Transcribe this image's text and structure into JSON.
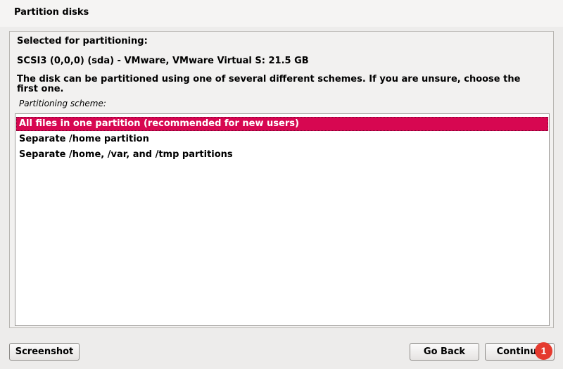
{
  "header": {
    "title": "Partition disks"
  },
  "panel": {
    "selected_label": "Selected for partitioning:",
    "disk": "SCSI3 (0,0,0) (sda) - VMware, VMware Virtual S: 21.5 GB",
    "description": "The disk can be partitioned using one of several different schemes. If you are unsure, choose the first one.",
    "scheme_label": "Partitioning scheme:"
  },
  "schemes": [
    {
      "label": "All files in one partition (recommended for new users)",
      "selected": true
    },
    {
      "label": "Separate /home partition",
      "selected": false
    },
    {
      "label": "Separate /home, /var, and /tmp partitions",
      "selected": false
    }
  ],
  "buttons": {
    "screenshot": "Screenshot",
    "back": "Go Back",
    "continue": "Continue"
  },
  "badge": {
    "number": "1",
    "color": "#e53a2e"
  },
  "colors": {
    "selection": "#d70751",
    "background": "#edeceb"
  }
}
